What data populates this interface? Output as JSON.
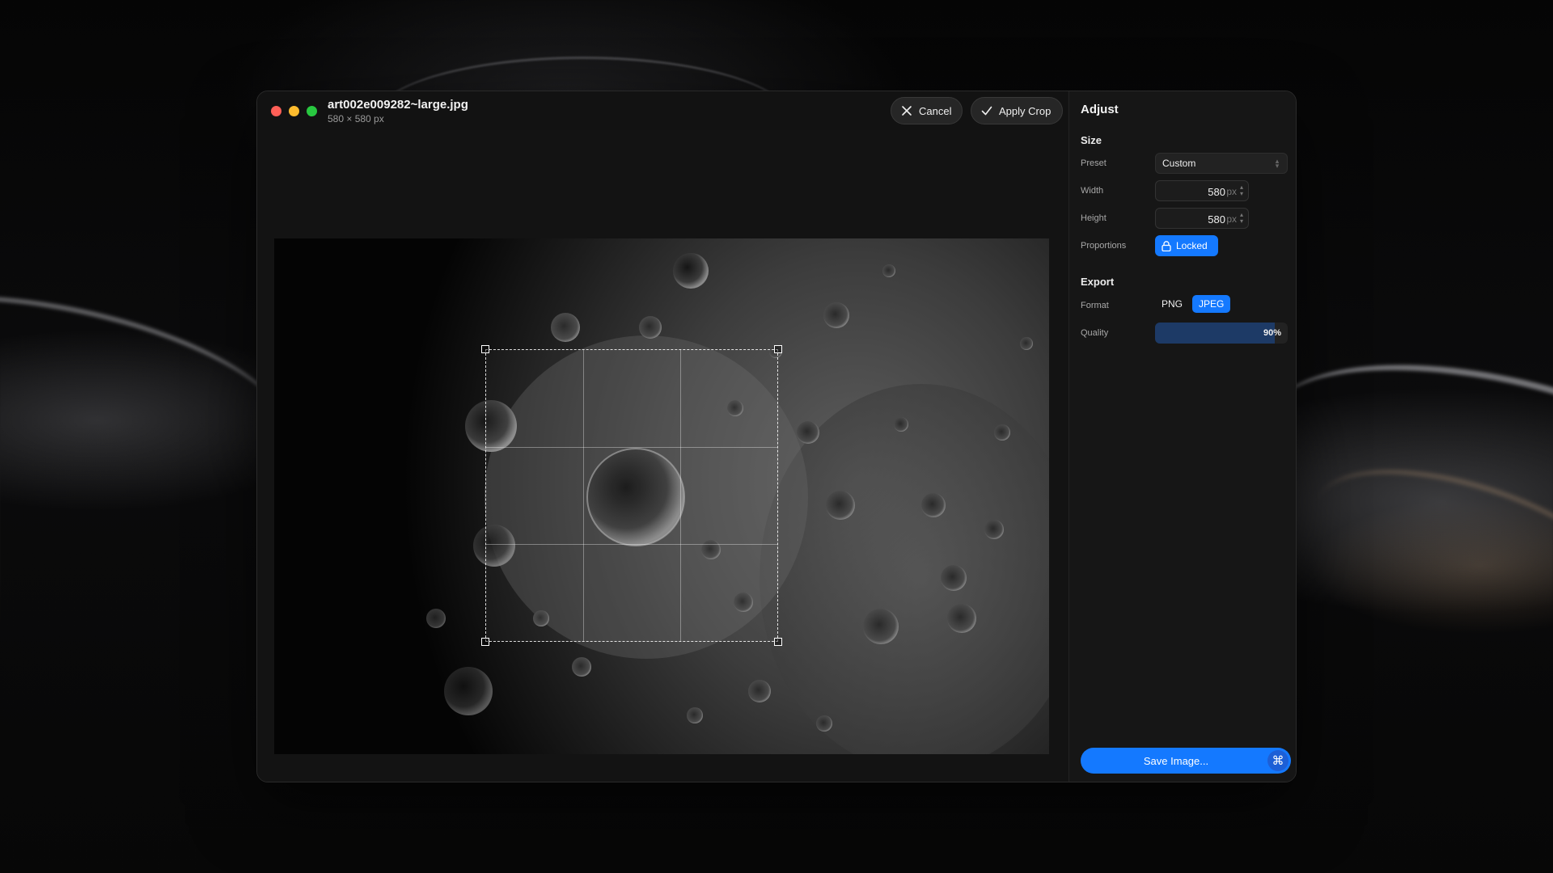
{
  "window": {
    "file_name": "art002e009282~large.jpg",
    "file_dims": "580 × 580 px"
  },
  "toolbar": {
    "cancel_label": "Cancel",
    "cancel_icon": "close-icon",
    "apply_label": "Apply Crop",
    "apply_icon": "checkmark-icon"
  },
  "sidebar": {
    "title": "Adjust",
    "size": {
      "section_title": "Size",
      "preset_label": "Preset",
      "preset_value": "Custom",
      "width_label": "Width",
      "width_value": "580",
      "height_label": "Height",
      "height_value": "580",
      "unit": "px",
      "proportions_label": "Proportions",
      "proportions_value": "Locked",
      "proportions_icon": "lock-icon"
    },
    "export": {
      "section_title": "Export",
      "format_label": "Format",
      "formats": [
        "PNG",
        "JPEG"
      ],
      "selected_format": "JPEG",
      "quality_label": "Quality",
      "quality_value": "90%",
      "quality_fraction": 0.9
    },
    "save_label": "Save Image...",
    "save_icon": "command-key-icon"
  },
  "colors": {
    "accent": "#1479ff",
    "window_bg": "#141414",
    "traffic_red": "#ff5f57",
    "traffic_yellow": "#febc2e",
    "traffic_green": "#28c840"
  }
}
